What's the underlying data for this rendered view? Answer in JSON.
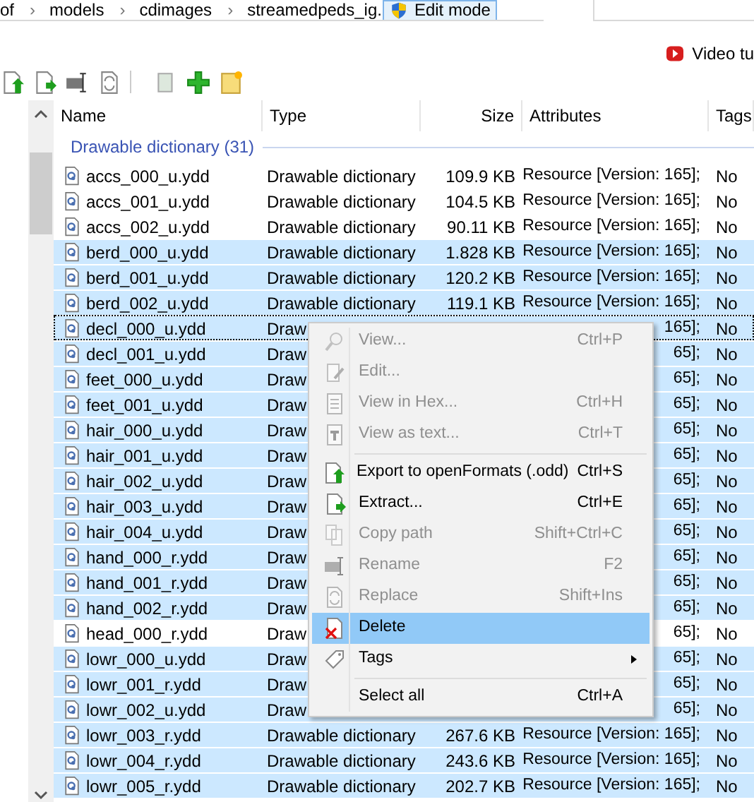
{
  "breadcrumb": [
    {
      "text": "of"
    },
    {
      "separator": "›",
      "text": "models"
    },
    {
      "separator": "›",
      "text": "cdimages"
    },
    {
      "separator": "›",
      "text": "streamedpeds_ig."
    }
  ],
  "edit_mode_button": "Edit mode",
  "video_link": "Video tu",
  "table": {
    "columns": [
      {
        "label": "Name"
      },
      {
        "label": "Type"
      },
      {
        "label": "Size"
      },
      {
        "label": "Attributes"
      },
      {
        "label": "Tags"
      }
    ],
    "group": "Drawable dictionary (31)",
    "rows": [
      {
        "name": "accs_000_u.ydd",
        "type": "Drawable dictionary",
        "size": "109.9 KB",
        "attributes": "Resource [Version: 165];",
        "tags": "No",
        "selected": false,
        "focused": false
      },
      {
        "name": "accs_001_u.ydd",
        "type": "Drawable dictionary",
        "size": "104.5 KB",
        "attributes": "Resource [Version: 165];",
        "tags": "No",
        "selected": false,
        "focused": false
      },
      {
        "name": "accs_002_u.ydd",
        "type": "Drawable dictionary",
        "size": "90.11 KB",
        "attributes": "Resource [Version: 165];",
        "tags": "No",
        "selected": false,
        "focused": false
      },
      {
        "name": "berd_000_u.ydd",
        "type": "Drawable dictionary",
        "size": "1.828 KB",
        "attributes": "Resource [Version: 165];",
        "tags": "No",
        "selected": true,
        "focused": false
      },
      {
        "name": "berd_001_u.ydd",
        "type": "Drawable dictionary",
        "size": "120.2 KB",
        "attributes": "Resource [Version: 165];",
        "tags": "No",
        "selected": true,
        "focused": false
      },
      {
        "name": "berd_002_u.ydd",
        "type": "Drawable dictionary",
        "size": "119.1 KB",
        "attributes": "Resource [Version: 165];",
        "tags": "No",
        "selected": true,
        "focused": false
      },
      {
        "name": "decl_000_u.ydd",
        "type": "Draw",
        "attributes": "165];",
        "tags": "No",
        "selected": true,
        "focused": true
      },
      {
        "name": "decl_001_u.ydd",
        "type": "Draw",
        "attributes": "65];",
        "tags": "No",
        "selected": true,
        "focused": false
      },
      {
        "name": "feet_000_u.ydd",
        "type": "Draw",
        "attributes": "65];",
        "tags": "No",
        "selected": true,
        "focused": false
      },
      {
        "name": "feet_001_u.ydd",
        "type": "Draw",
        "attributes": "65];",
        "tags": "No",
        "selected": true,
        "focused": false
      },
      {
        "name": "hair_000_u.ydd",
        "type": "Draw",
        "attributes": "65];",
        "tags": "No",
        "selected": true,
        "focused": false
      },
      {
        "name": "hair_001_u.ydd",
        "type": "Draw",
        "attributes": "65];",
        "tags": "No",
        "selected": true,
        "focused": false
      },
      {
        "name": "hair_002_u.ydd",
        "type": "Draw",
        "attributes": "65];",
        "tags": "No",
        "selected": true,
        "focused": false
      },
      {
        "name": "hair_003_u.ydd",
        "type": "Draw",
        "attributes": "65];",
        "tags": "No",
        "selected": true,
        "focused": false
      },
      {
        "name": "hair_004_u.ydd",
        "type": "Draw",
        "attributes": "65];",
        "tags": "No",
        "selected": true,
        "focused": false
      },
      {
        "name": "hand_000_r.ydd",
        "type": "Draw",
        "attributes": "65];",
        "tags": "No",
        "selected": true,
        "focused": false
      },
      {
        "name": "hand_001_r.ydd",
        "type": "Draw",
        "attributes": "65];",
        "tags": "No",
        "selected": true,
        "focused": false
      },
      {
        "name": "hand_002_r.ydd",
        "type": "Draw",
        "attributes": "65];",
        "tags": "No",
        "selected": true,
        "focused": false
      },
      {
        "name": "head_000_r.ydd",
        "type": "Draw",
        "attributes": "65];",
        "tags": "No",
        "selected": false,
        "focused": false
      },
      {
        "name": "lowr_000_u.ydd",
        "type": "Draw",
        "attributes": "65];",
        "tags": "No",
        "selected": true,
        "focused": false
      },
      {
        "name": "lowr_001_r.ydd",
        "type": "Draw",
        "attributes": "65];",
        "tags": "No",
        "selected": true,
        "focused": false
      },
      {
        "name": "lowr_002_u.ydd",
        "type": "Draw",
        "attributes": "65];",
        "tags": "No",
        "selected": true,
        "focused": false
      },
      {
        "name": "lowr_003_r.ydd",
        "type": "Drawable dictionary",
        "size": "267.6 KB",
        "attributes": "Resource [Version: 165];",
        "tags": "No",
        "selected": true,
        "focused": false
      },
      {
        "name": "lowr_004_r.ydd",
        "type": "Drawable dictionary",
        "size": "243.6 KB",
        "attributes": "Resource [Version: 165];",
        "tags": "No",
        "selected": true,
        "focused": false
      },
      {
        "name": "lowr_005_r.ydd",
        "type": "Drawable dictionary",
        "size": "202.7 KB",
        "attributes": "Resource [Version: 165];",
        "tags": "No",
        "selected": true,
        "focused": false
      }
    ]
  },
  "context_menu": [
    {
      "kind": "item",
      "label": "View...",
      "shortcut": "Ctrl+P",
      "disabled": true,
      "selected": false
    },
    {
      "kind": "item",
      "label": "Edit...",
      "disabled": true,
      "selected": false
    },
    {
      "kind": "item",
      "label": "View in Hex...",
      "shortcut": "Ctrl+H",
      "disabled": true,
      "selected": false
    },
    {
      "kind": "item",
      "label": "View as text...",
      "shortcut": "Ctrl+T",
      "disabled": true,
      "selected": false
    },
    {
      "kind": "separator"
    },
    {
      "kind": "item",
      "label": "Export to openFormats (.odd)",
      "shortcut": "Ctrl+S",
      "disabled": false,
      "selected": false
    },
    {
      "kind": "item",
      "label": "Extract...",
      "shortcut": "Ctrl+E",
      "disabled": false,
      "selected": false
    },
    {
      "kind": "item",
      "label": "Copy path",
      "shortcut": "Shift+Ctrl+C",
      "disabled": true,
      "selected": false
    },
    {
      "kind": "item",
      "label": "Rename",
      "shortcut": "F2",
      "disabled": true,
      "selected": false
    },
    {
      "kind": "item",
      "label": "Replace",
      "shortcut": "Shift+Ins",
      "disabled": true,
      "selected": false
    },
    {
      "kind": "item",
      "label": "Delete",
      "disabled": false,
      "selected": true
    },
    {
      "kind": "submenu",
      "label": "Tags",
      "disabled": false,
      "selected": false
    },
    {
      "kind": "separator"
    },
    {
      "kind": "item",
      "label": "Select all",
      "shortcut": "Ctrl+A",
      "disabled": false,
      "selected": false
    }
  ]
}
